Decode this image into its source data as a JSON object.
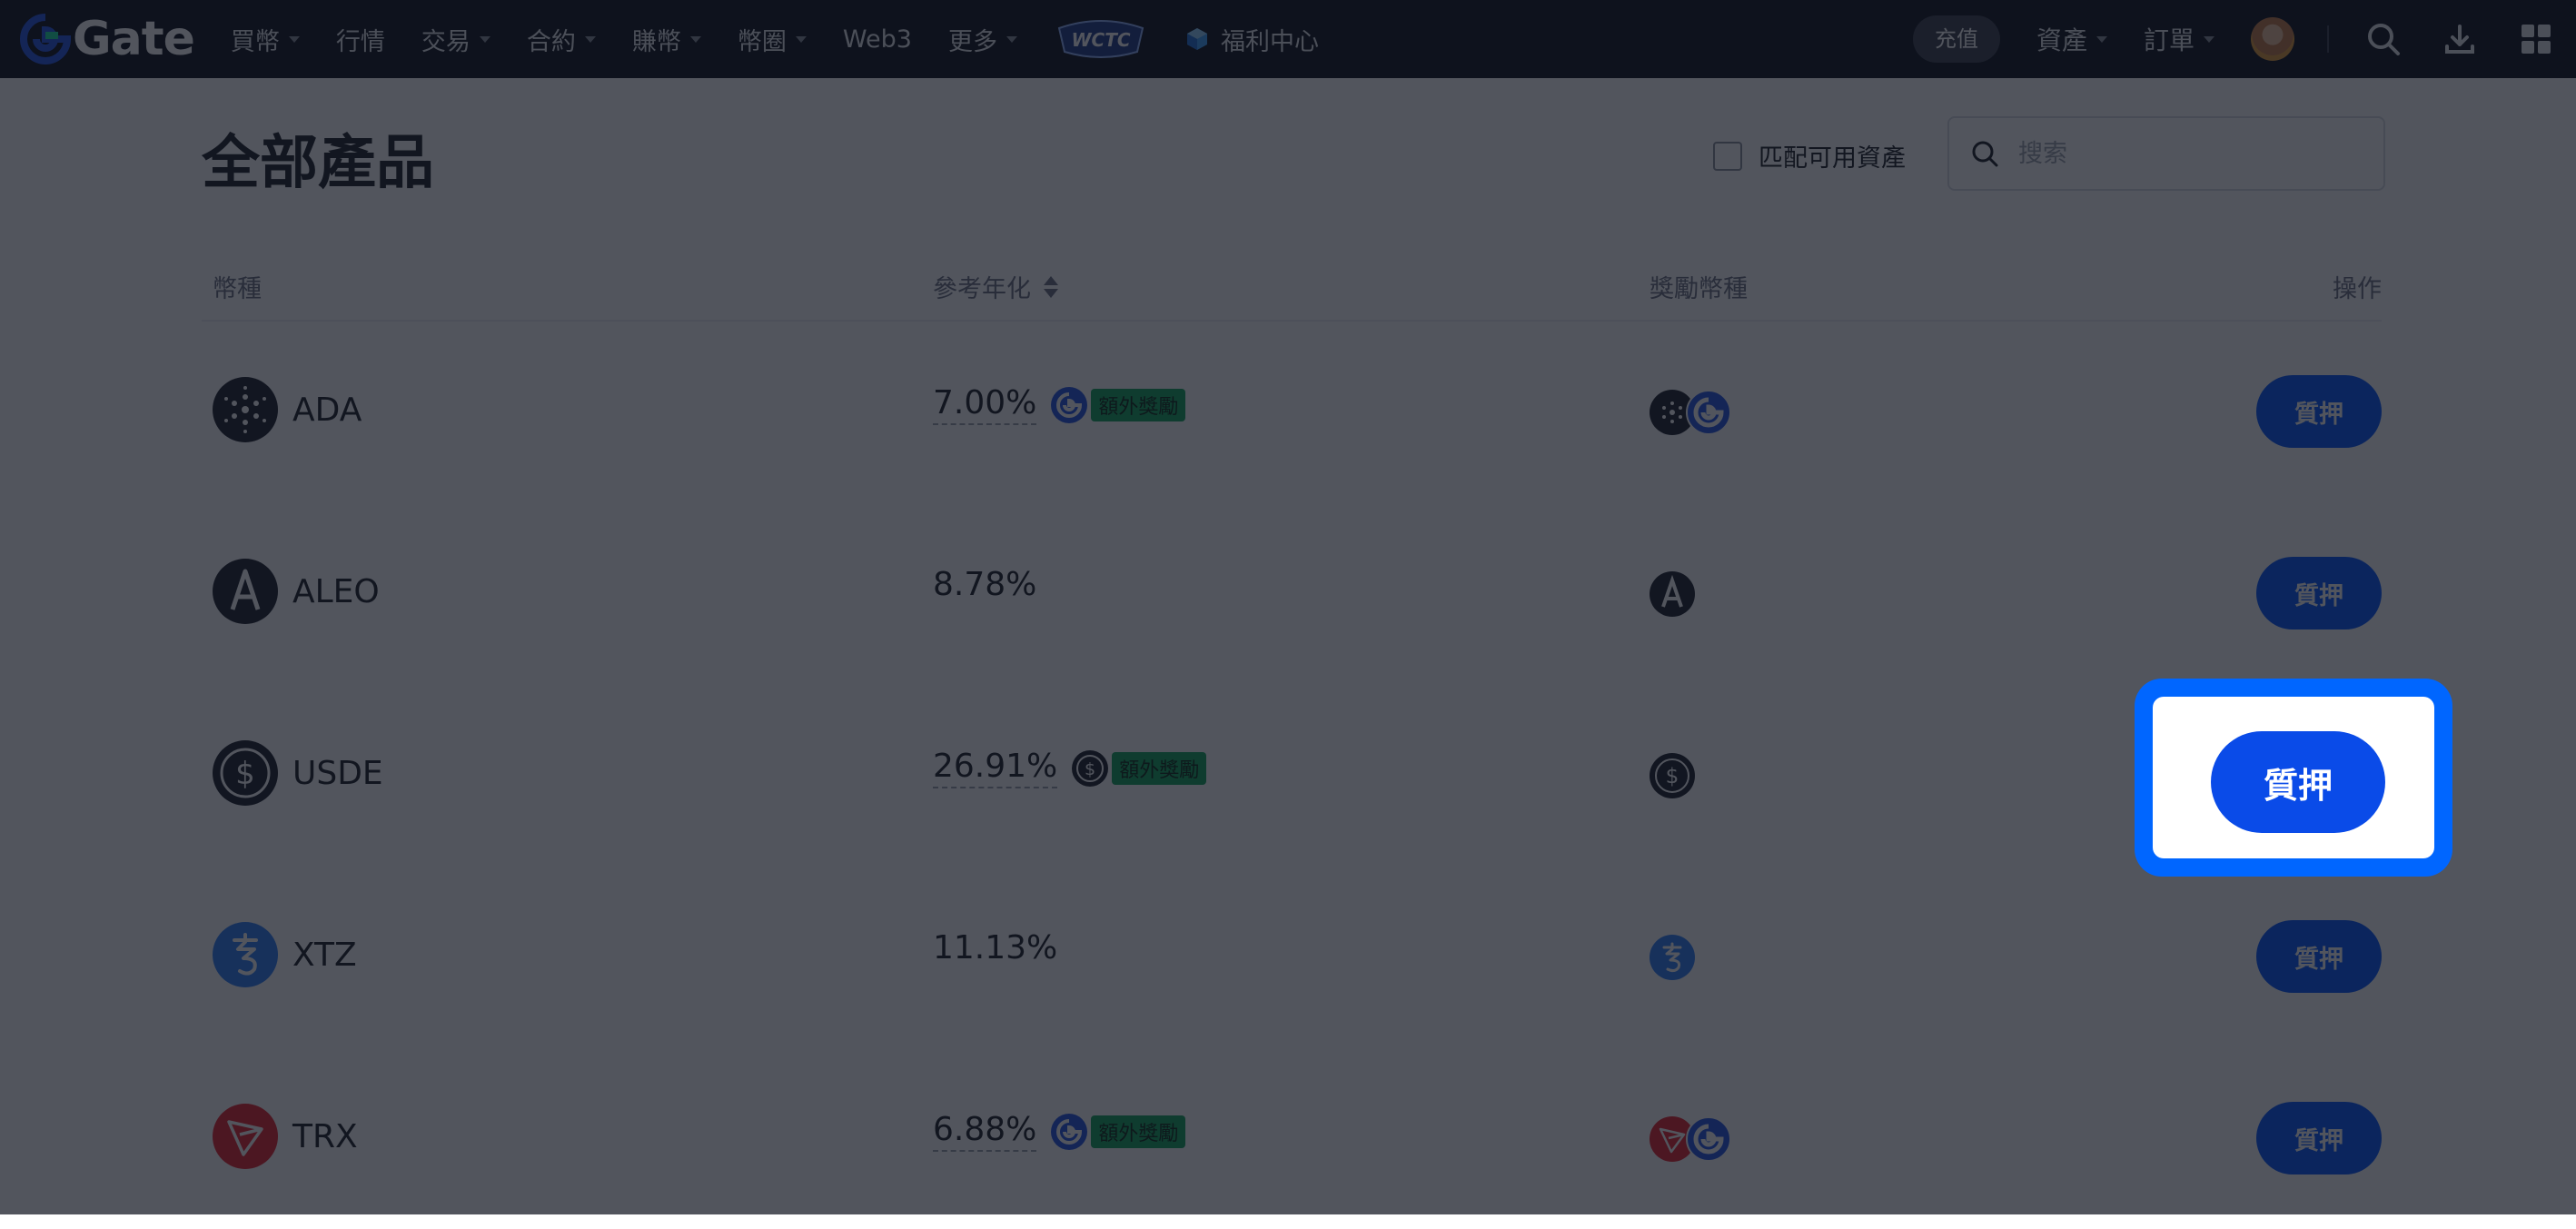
{
  "brand": {
    "name": "Gate",
    "accent": "#0055ff",
    "bonus_green": "#11a75a"
  },
  "nav": {
    "items": [
      {
        "label": "買幣",
        "dropdown": true
      },
      {
        "label": "行情",
        "dropdown": false
      },
      {
        "label": "交易",
        "dropdown": true
      },
      {
        "label": "合約",
        "dropdown": true
      },
      {
        "label": "賺幣",
        "dropdown": true
      },
      {
        "label": "幣圈",
        "dropdown": true
      },
      {
        "label": "Web3",
        "dropdown": false
      },
      {
        "label": "更多",
        "dropdown": true
      }
    ],
    "wctc_label": "WCTC",
    "welfare_label": "福利中心",
    "deposit_label": "充值",
    "assets_label": "資產",
    "orders_label": "訂單"
  },
  "page": {
    "title": "全部產品",
    "match_label": "匹配可用資產",
    "search_placeholder": "搜索"
  },
  "table": {
    "headers": {
      "coin": "幣種",
      "apy": "參考年化",
      "reward": "獎勵幣種",
      "action": "操作"
    },
    "rows": [
      {
        "coin": "ADA",
        "apy": "7.00%",
        "bonus": "額外獎勵",
        "action": "質押",
        "icon": "ada-icon",
        "bonus_icon": "gate-icon",
        "rewards": [
          "ada-icon",
          "gate-icon"
        ]
      },
      {
        "coin": "ALEO",
        "apy": "8.78%",
        "bonus": "",
        "action": "質押",
        "icon": "aleo-icon",
        "bonus_icon": "",
        "rewards": [
          "aleo-icon"
        ]
      },
      {
        "coin": "USDE",
        "apy": "26.91%",
        "bonus": "額外獎勵",
        "action": "質押",
        "icon": "usde-icon",
        "bonus_icon": "usde-icon",
        "rewards": [
          "usde-icon"
        ]
      },
      {
        "coin": "XTZ",
        "apy": "11.13%",
        "bonus": "",
        "action": "質押",
        "icon": "xtz-icon",
        "bonus_icon": "",
        "rewards": [
          "xtz-icon"
        ]
      },
      {
        "coin": "TRX",
        "apy": "6.88%",
        "bonus": "額外獎勵",
        "action": "質押",
        "icon": "trx-icon",
        "bonus_icon": "gate-icon",
        "rewards": [
          "trx-icon",
          "gate-icon"
        ]
      }
    ]
  },
  "highlight": {
    "label": "質押"
  }
}
